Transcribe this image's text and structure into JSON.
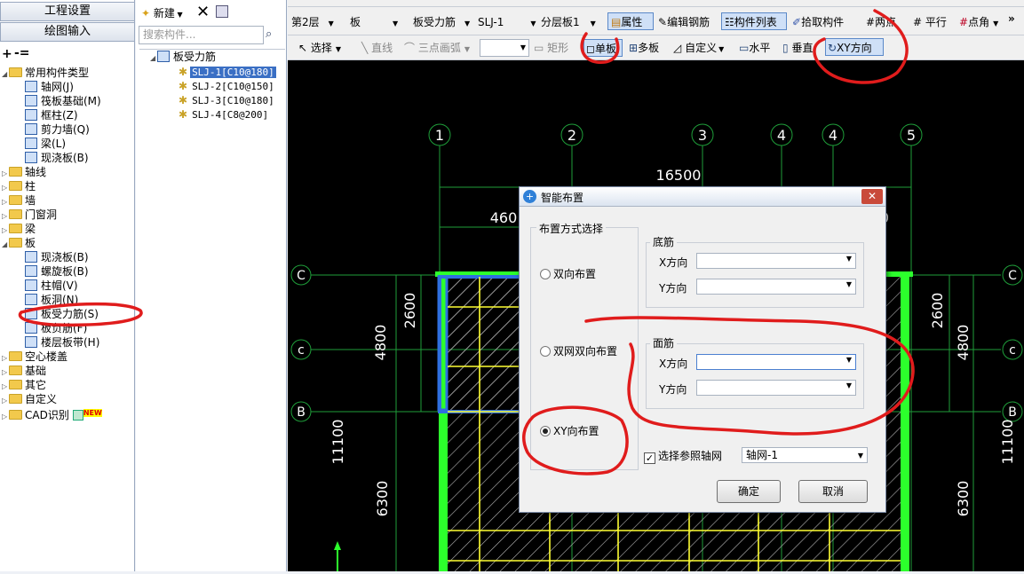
{
  "left_panel": {
    "btn_engineering": "工程设置",
    "btn_drawing": "绘图输入",
    "tree": [
      {
        "label": "常用构件类型",
        "level": 0,
        "expanded": true,
        "folder": true
      },
      {
        "label": "轴网(J)",
        "level": 1
      },
      {
        "label": "筏板基础(M)",
        "level": 1
      },
      {
        "label": "框柱(Z)",
        "level": 1
      },
      {
        "label": "剪力墙(Q)",
        "level": 1
      },
      {
        "label": "梁(L)",
        "level": 1
      },
      {
        "label": "现浇板(B)",
        "level": 1
      },
      {
        "label": "轴线",
        "level": 0,
        "folder": true
      },
      {
        "label": "柱",
        "level": 0,
        "folder": true
      },
      {
        "label": "墙",
        "level": 0,
        "folder": true
      },
      {
        "label": "门窗洞",
        "level": 0,
        "folder": true
      },
      {
        "label": "梁",
        "level": 0,
        "folder": true
      },
      {
        "label": "板",
        "level": 0,
        "expanded": true,
        "folder": true
      },
      {
        "label": "现浇板(B)",
        "level": 1
      },
      {
        "label": "螺旋板(B)",
        "level": 1
      },
      {
        "label": "柱帽(V)",
        "level": 1
      },
      {
        "label": "板洞(N)",
        "level": 1
      },
      {
        "label": "板受力筋(S)",
        "level": 1
      },
      {
        "label": "板负筋(F)",
        "level": 1
      },
      {
        "label": "楼层板带(H)",
        "level": 1
      },
      {
        "label": "空心楼盖",
        "level": 0,
        "folder": true
      },
      {
        "label": "基础",
        "level": 0,
        "folder": true
      },
      {
        "label": "其它",
        "level": 0,
        "folder": true
      },
      {
        "label": "自定义",
        "level": 0,
        "folder": true
      },
      {
        "label": "CAD识别",
        "level": 0,
        "folder": true,
        "badge": "NEW"
      }
    ]
  },
  "mid_panel": {
    "new_label": "新建",
    "search_placeholder": "搜索构件...",
    "root": "板受力筋",
    "items": [
      "SLJ-1[C10@180]",
      "SLJ-2[C10@150]",
      "SLJ-3[C10@180]",
      "SLJ-4[C8@200]"
    ],
    "selected_index": 0
  },
  "toolbar1": {
    "floor": "第2层",
    "category": "板",
    "type": "板受力筋",
    "component": "SLJ-1",
    "layer": "分层板1",
    "btn_props": "属性",
    "btn_edit_rebar": "编辑钢筋",
    "btn_comp_list": "构件列表",
    "btn_pick": "拾取构件",
    "btn_two_points": "两点",
    "btn_parallel": "平行",
    "btn_point_angle": "点角"
  },
  "toolbar2": {
    "select": "选择",
    "line": "直线",
    "arc3": "三点画弧",
    "rect": "矩形",
    "single_board": "单板",
    "multi_board": "多板",
    "custom": "自定义",
    "horizontal": "水平",
    "vertical": "垂直",
    "xy_direction": "XY方向"
  },
  "canvas": {
    "axis_top": [
      "1",
      "2",
      "3",
      "4",
      "4",
      "5"
    ],
    "axis_side": [
      "C",
      "c",
      "B"
    ],
    "dim_total": "16500",
    "dim_partial": "460",
    "dim_right_partial": "0",
    "dim_2600": "2600",
    "dim_4800": "4800",
    "dim_11100": "11100",
    "dim_6300": "6300"
  },
  "dialog": {
    "title": "智能布置",
    "group_method": "布置方式选择",
    "opt_double": "双向布置",
    "opt_double_net": "双网双向布置",
    "opt_xy": "XY向布置",
    "selected_option": "XY向布置",
    "group_bottom": "底筋",
    "group_top": "面筋",
    "x_dir": "X方向",
    "y_dir": "Y方向",
    "chk_ref_axis": "选择参照轴网",
    "axis_value": "轴网-1",
    "btn_ok": "确定",
    "btn_cancel": "取消"
  },
  "colors": {
    "canvas_bg": "#000000",
    "axis_line": "#1f9e3a",
    "slab_fill": "#b7b7b7",
    "rebar": "#ffff33",
    "highlight_blue": "#2f6fe0",
    "wall": "#2cff2c",
    "annotation_red": "#e01c1c"
  }
}
